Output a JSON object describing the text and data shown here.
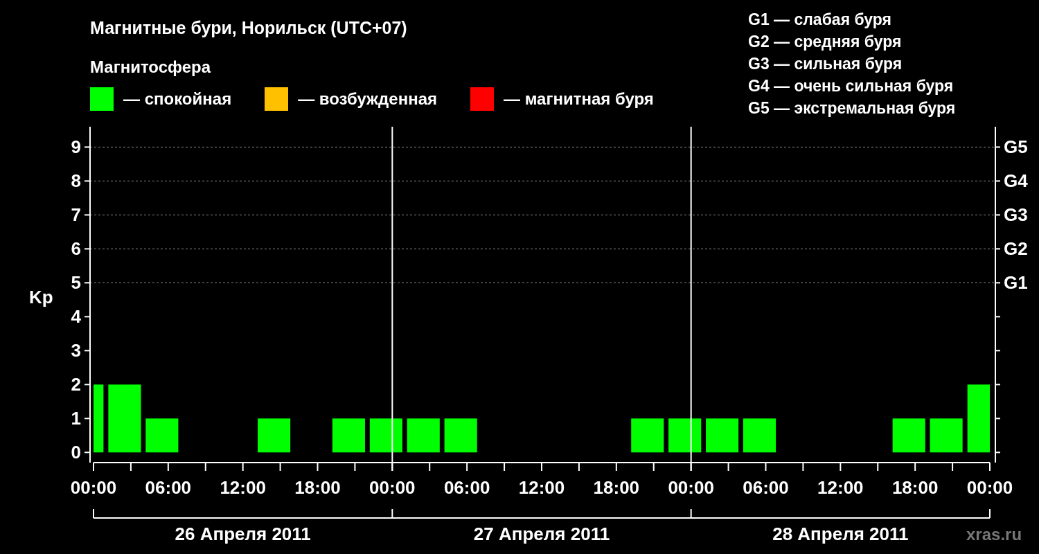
{
  "title": "Магнитные бури, Норильск (UTC+07)",
  "subtitle": "Магнитосфера",
  "legend": [
    {
      "label": "— спокойная",
      "color": "#00ff00"
    },
    {
      "label": "— возбужденная",
      "color": "#ffc000"
    },
    {
      "label": "— магнитная буря",
      "color": "#ff0000"
    }
  ],
  "storm_scale": [
    "G1 — слабая буря",
    "G2 — средняя буря",
    "G3 — сильная буря",
    "G4 — очень сильная буря",
    "G5 — экстремальная буря"
  ],
  "chart": {
    "chart_data": {
      "type": "bar",
      "ylabel": "Kp",
      "x": [
        "2011-04-26T00:24",
        "2011-04-26T02:30",
        "2011-04-26T05:30",
        "2011-04-26T08:30",
        "2011-04-26T11:30",
        "2011-04-26T14:30",
        "2011-04-26T17:30",
        "2011-04-26T20:30",
        "2011-04-26T23:30",
        "2011-04-27T02:30",
        "2011-04-27T05:30",
        "2011-04-27T08:30",
        "2011-04-27T11:30",
        "2011-04-27T14:30",
        "2011-04-27T17:30",
        "2011-04-27T20:30",
        "2011-04-27T23:30",
        "2011-04-28T02:30",
        "2011-04-28T05:30",
        "2011-04-28T08:30",
        "2011-04-28T11:30",
        "2011-04-28T14:30",
        "2011-04-28T17:30",
        "2011-04-28T20:30",
        "2011-04-28T23:06"
      ],
      "values": [
        2,
        2,
        1,
        0,
        0,
        1,
        0,
        1,
        1,
        1,
        1,
        0,
        0,
        0,
        0,
        1,
        1,
        1,
        1,
        0,
        0,
        0,
        1,
        1,
        2
      ],
      "xlim": [
        "2011-04-26T00:00",
        "2011-04-29T00:00"
      ],
      "ylim": [
        -0.3,
        9.6
      ],
      "xticks": [
        {
          "value": "2011-04-26T00:00",
          "label": "00:00"
        },
        {
          "value": "2011-04-26T06:00",
          "label": "06:00"
        },
        {
          "value": "2011-04-26T12:00",
          "label": "12:00"
        },
        {
          "value": "2011-04-26T18:00",
          "label": "18:00"
        },
        {
          "value": "2011-04-27T00:00",
          "label": "00:00"
        },
        {
          "value": "2011-04-27T06:00",
          "label": "06:00"
        },
        {
          "value": "2011-04-27T12:00",
          "label": "12:00"
        },
        {
          "value": "2011-04-27T18:00",
          "label": "18:00"
        },
        {
          "value": "2011-04-28T00:00",
          "label": "00:00"
        },
        {
          "value": "2011-04-28T06:00",
          "label": "06:00"
        },
        {
          "value": "2011-04-28T12:00",
          "label": "12:00"
        },
        {
          "value": "2011-04-28T18:00",
          "label": "18:00"
        },
        {
          "value": "2011-04-29T00:00",
          "label": "00:00"
        }
      ],
      "yticks": [
        0,
        1,
        2,
        3,
        4,
        5,
        6,
        7,
        8,
        9
      ],
      "grid": true,
      "annotations": [
        "G1",
        "G2",
        "G3",
        "G4",
        "G5"
      ]
    },
    "days": [
      "26 Апреля 2011",
      "27 Апреля 2011",
      "28 Апреля 2011"
    ],
    "credit": "xras.ru"
  }
}
